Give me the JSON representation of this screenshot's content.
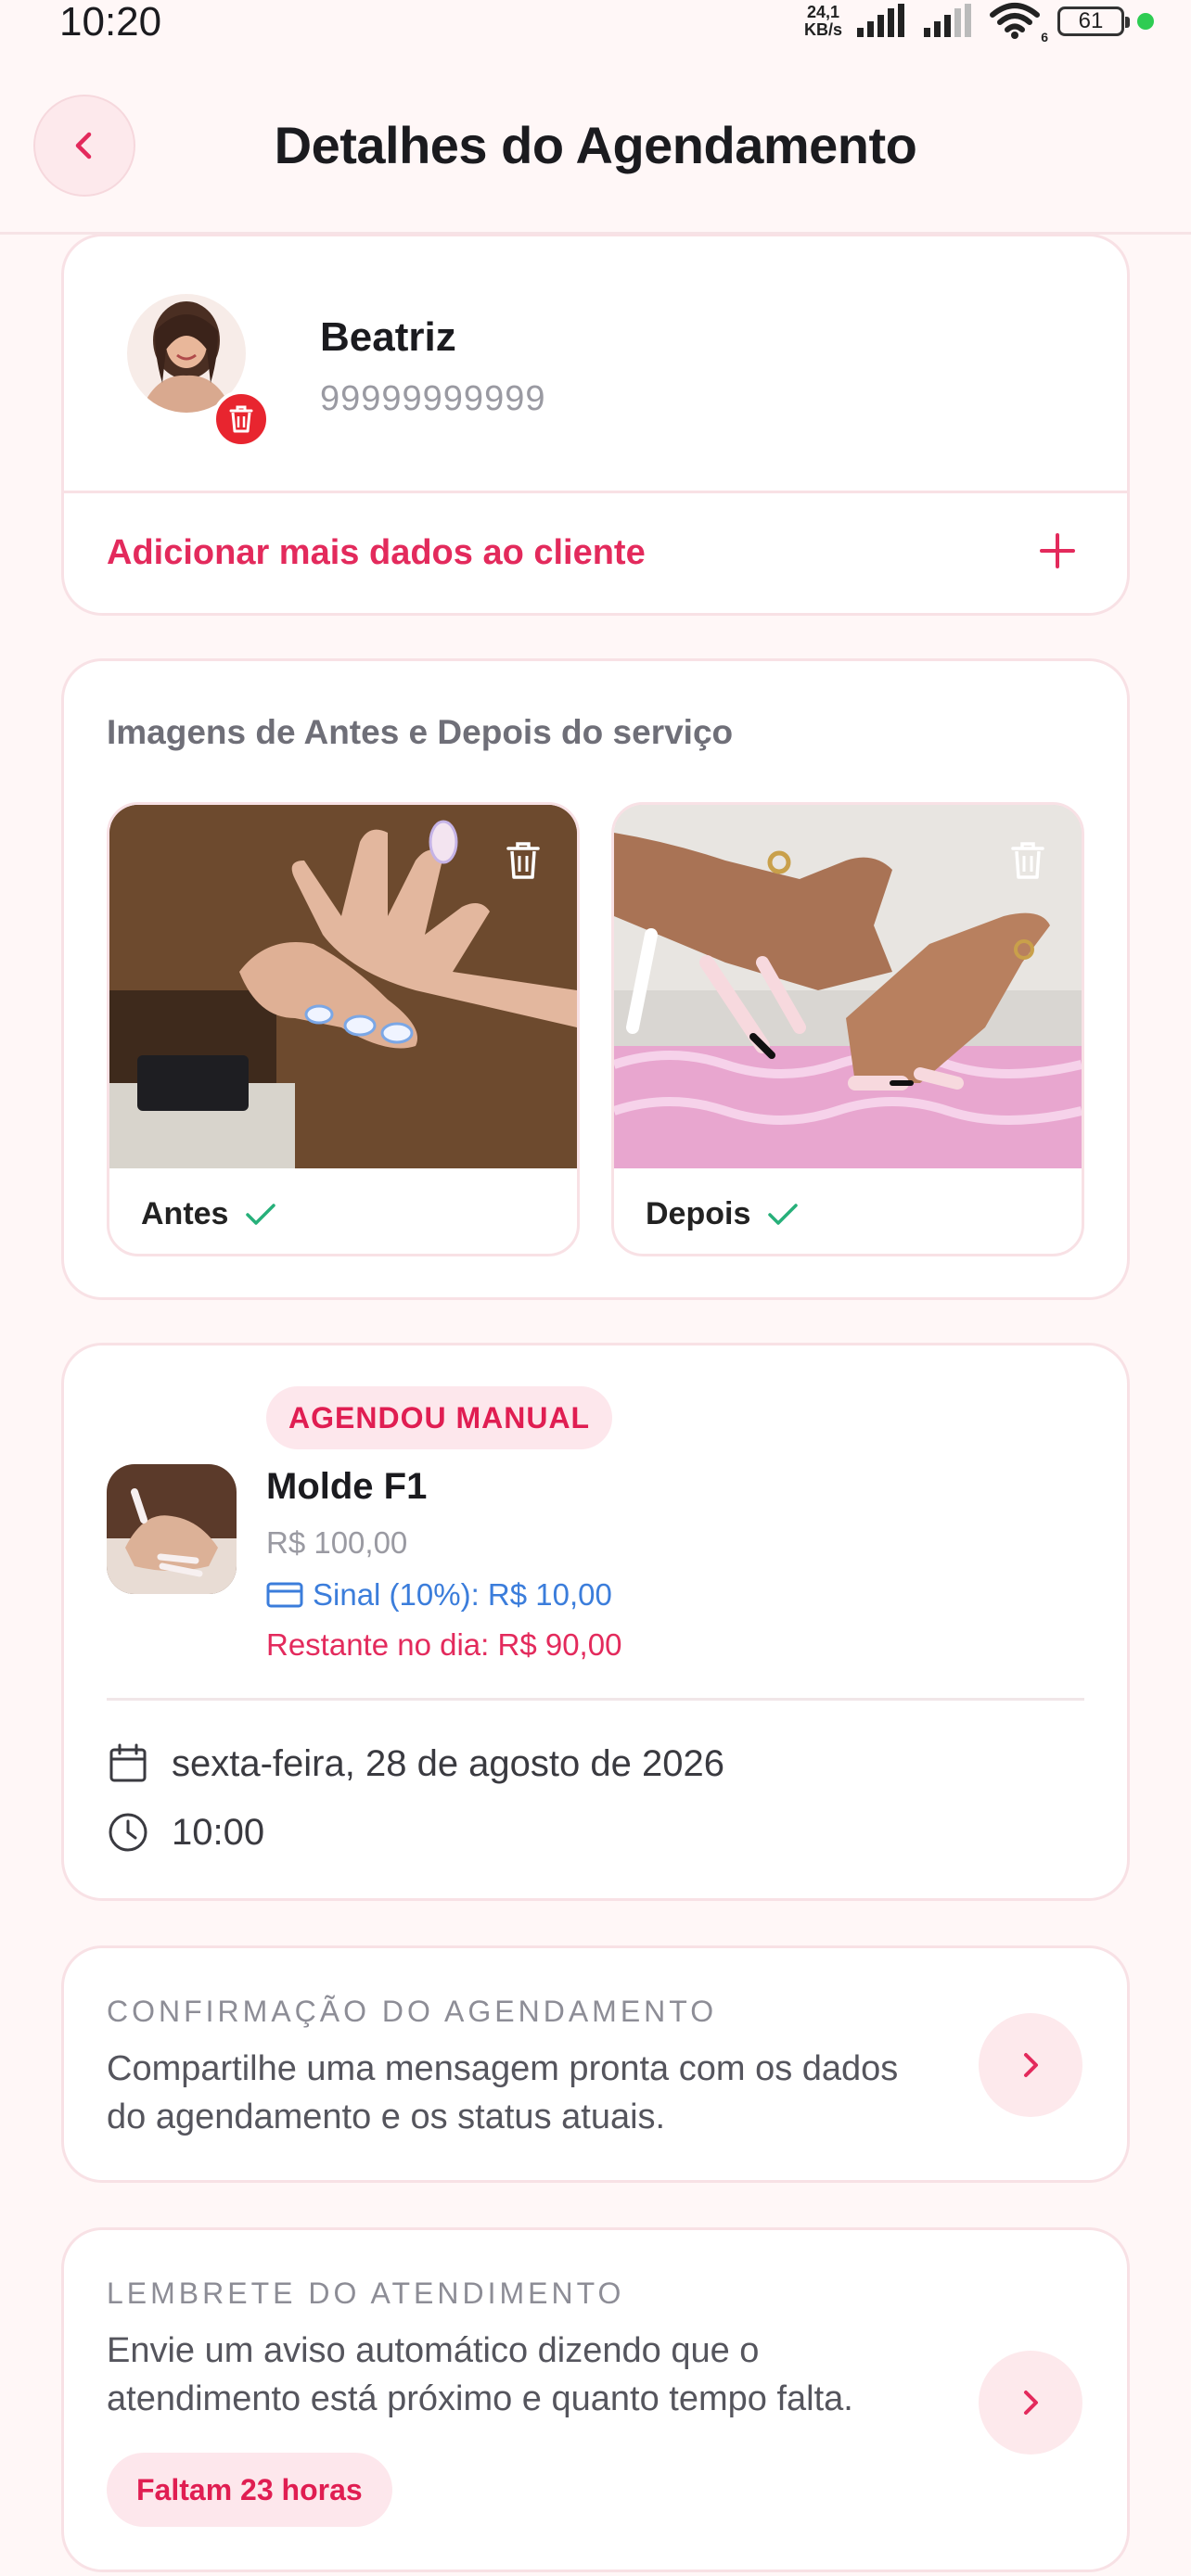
{
  "status_bar": {
    "time": "10:20",
    "net_speed_value": "24,1",
    "net_speed_unit": "KB/s",
    "wifi_badge": "6",
    "battery": "61"
  },
  "header": {
    "title": "Detalhes do Agendamento",
    "back_icon": "chevron-left-icon"
  },
  "client": {
    "name": "Beatriz",
    "phone": "99999999999",
    "add_data_label": "Adicionar mais dados ao cliente"
  },
  "images": {
    "title": "Imagens de Antes e Depois do serviço",
    "before_label": "Antes",
    "after_label": "Depois"
  },
  "service": {
    "badge": "AGENDOU MANUAL",
    "name": "Molde F1",
    "price": "R$ 100,00",
    "deposit": "Sinal (10%): R$ 10,00",
    "remaining": "Restante no dia: R$ 90,00",
    "date": "sexta-feira, 28 de agosto de 2026",
    "time": "10:00"
  },
  "confirmation": {
    "title": "CONFIRMAÇÃO DO AGENDAMENTO",
    "description": "Compartilhe uma mensagem pronta com os dados do agendamento e os status atuais."
  },
  "reminder": {
    "title": "LEMBRETE DO ATENDIMENTO",
    "description": "Envie um aviso automático dizendo que o atendimento está próximo e quanto tempo falta.",
    "badge": "Faltam 23 horas"
  },
  "colors": {
    "accent": "#e32a5c",
    "accent_bg": "#fde9ec",
    "link_blue": "#3b7ddb",
    "check_green": "#27b07a",
    "background": "#fff7f7"
  }
}
